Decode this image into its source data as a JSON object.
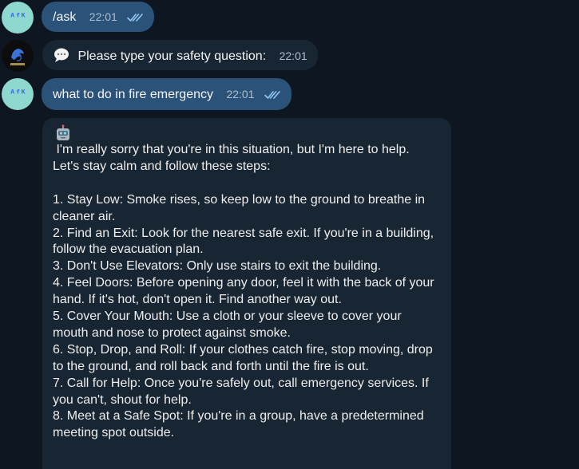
{
  "messages": [
    {
      "sender": "user",
      "avatar_text": "ᴬᶠᴷ",
      "text": "/ask",
      "time": "22:01",
      "status": "read"
    },
    {
      "sender": "bot",
      "prompt_icon": "speech-bubble-icon",
      "text": "Please type your safety question:",
      "time": "22:01"
    },
    {
      "sender": "user",
      "avatar_text": "ᴬᶠᴷ",
      "text": "what to do in fire emergency",
      "time": "22:01",
      "status": "read"
    }
  ],
  "reply": {
    "icon": "robot-icon",
    "lines": [
      " I'm really sorry that you're in this situation, but I'm here to help.",
      "Let's stay calm and follow these steps:",
      "",
      "1. Stay Low: Smoke rises, so keep low to the ground to breathe in",
      "cleaner air.",
      "2. Find an Exit: Look for the nearest safe exit. If you're in a building,",
      "follow the evacuation plan.",
      "3. Don't Use Elevators: Only use stairs to exit the building.",
      "4. Feel Doors: Before opening any door, feel it with the back of your",
      "hand. If it's hot, don't open it. Find another way out.",
      "5. Cover Your Mouth: Use a cloth or your sleeve to cover your",
      "mouth and nose to protect against smoke.",
      "6. Stop, Drop, and Roll: If your clothes catch fire, stop moving, drop",
      "to the ground, and roll back and forth until the fire is out.",
      "7. Call for Help: Once you're safely out, call emergency services. If",
      "you can't, shout for help.",
      "8. Meet at a Safe Spot: If you're in a group, have a predetermined",
      "meeting spot outside."
    ]
  },
  "colors": {
    "background": "#0e1621",
    "outgoing_bubble": "#2b5278",
    "incoming_bubble": "#182533",
    "meta_text": "#aebfd0",
    "read_ticks": "#6fb8f0"
  }
}
